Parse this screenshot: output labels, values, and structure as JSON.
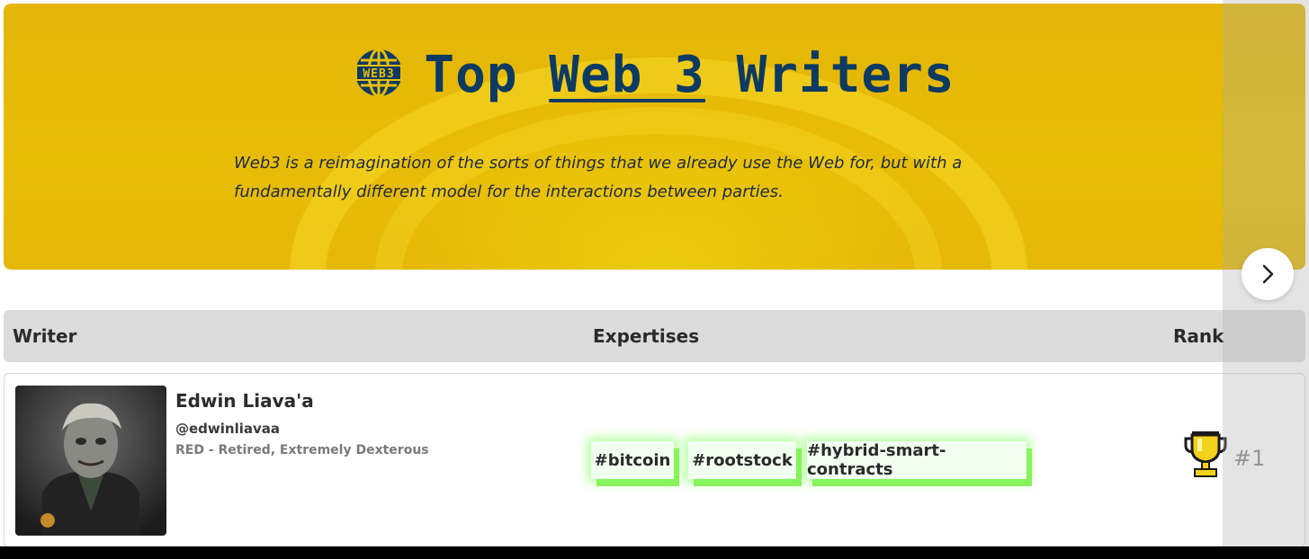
{
  "hero": {
    "title_prefix": "Top ",
    "title_topic": "Web 3",
    "title_suffix": " Writers",
    "icon": "web3-globe-icon",
    "description": "Web3 is a reimagination of the sorts of things that we already use the Web for, but with a fundamentally different model for the interactions between parties."
  },
  "nav": {
    "next_icon": "chevron-right-icon"
  },
  "table": {
    "headers": {
      "writer": "Writer",
      "expertises": "Expertises",
      "rank": "Rank"
    },
    "rows": [
      {
        "name": "Edwin Liava'a",
        "handle": "@edwinliavaa",
        "bio": "RED - Retired, Extremely Dexterous",
        "tags": [
          "#bitcoin",
          "#rootstock",
          "#hybrid-smart-contracts"
        ],
        "rank_icon": "trophy-icon",
        "rank": "#1"
      }
    ]
  },
  "colors": {
    "banner": "#e8bd06",
    "title": "#0c3a62",
    "tag_glow": "#8cf060"
  }
}
